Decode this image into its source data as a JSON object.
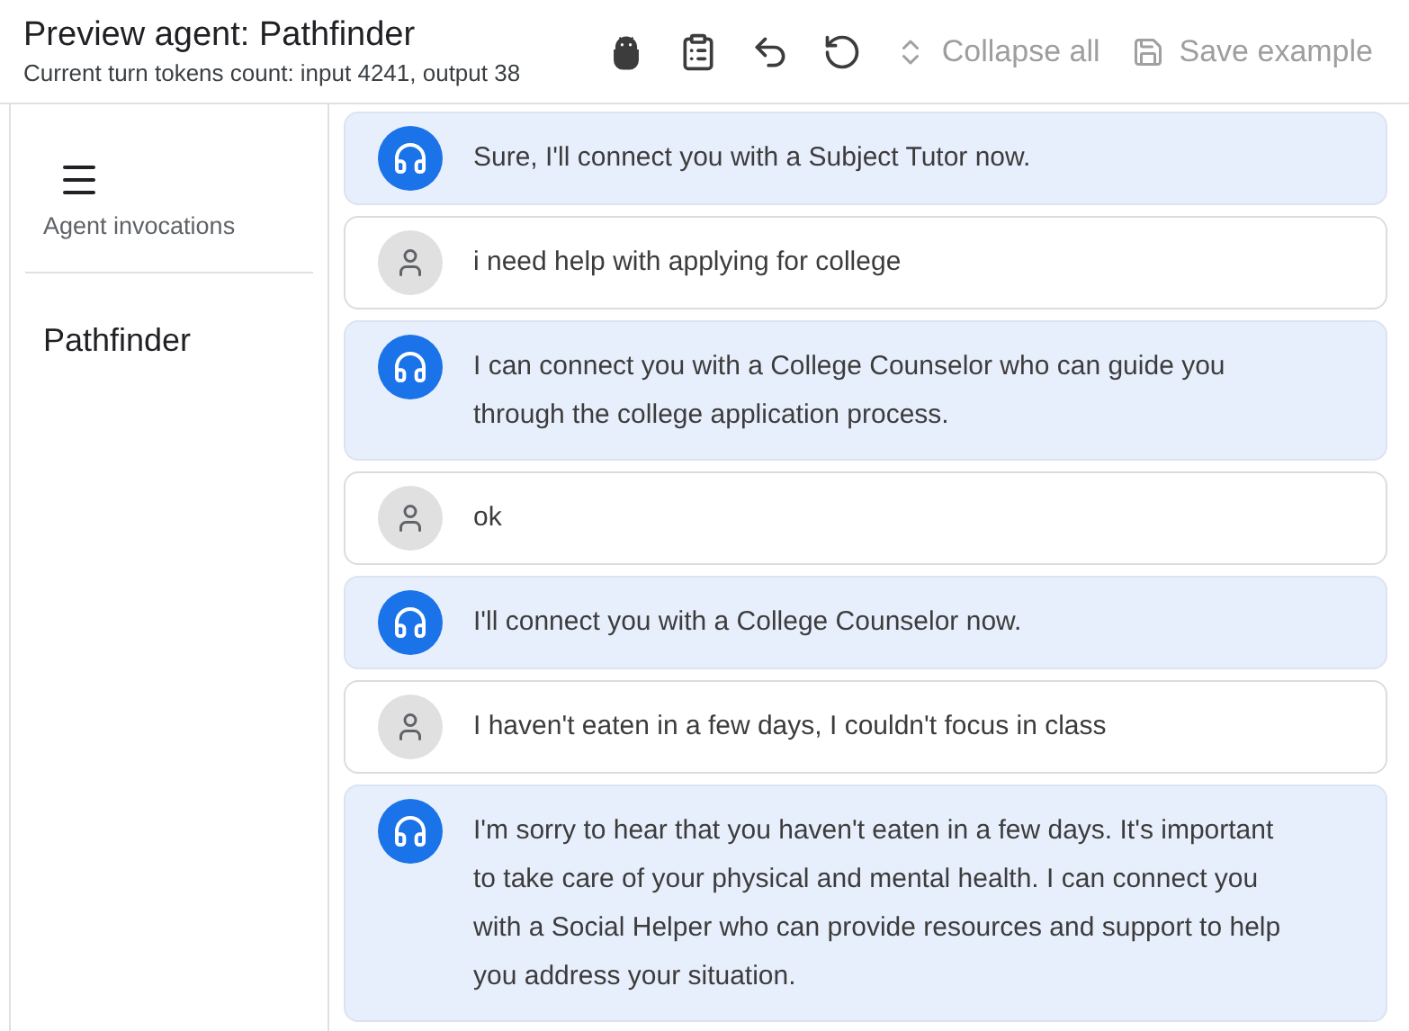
{
  "header": {
    "title": "Preview agent: Pathfinder",
    "subtitle": "Current turn tokens count: input 4241, output 38",
    "toolbar": [
      {
        "kind": "android",
        "disabled": false
      },
      {
        "kind": "clipboard",
        "disabled": false
      },
      {
        "kind": "undo",
        "disabled": false
      },
      {
        "kind": "refresh",
        "disabled": false
      },
      {
        "kind": "collapse",
        "label": "Collapse all",
        "disabled": true
      },
      {
        "kind": "save",
        "label": "Save example",
        "disabled": true
      }
    ]
  },
  "sidebar": {
    "section_label": "Agent invocations",
    "items": [
      {
        "label": "Pathfinder"
      }
    ]
  },
  "messages": [
    {
      "kind": "agent",
      "text": "Sure, I'll connect you with a Subject Tutor now."
    },
    {
      "kind": "user",
      "text": "i need help with applying for college"
    },
    {
      "kind": "agent",
      "text": "I can connect you with a College Counselor who can guide you through the college application process."
    },
    {
      "kind": "user",
      "text": "ok"
    },
    {
      "kind": "agent",
      "text": "I'll connect you with a College Counselor now."
    },
    {
      "kind": "user",
      "text": "I haven't eaten in a few days, I couldn't focus in class"
    },
    {
      "kind": "agent",
      "text": "I'm sorry to hear that you haven't eaten in a few days. It's important to take care of your physical and mental health. I can connect you with a Social Helper who can provide resources and support to help you address your situation."
    }
  ]
}
